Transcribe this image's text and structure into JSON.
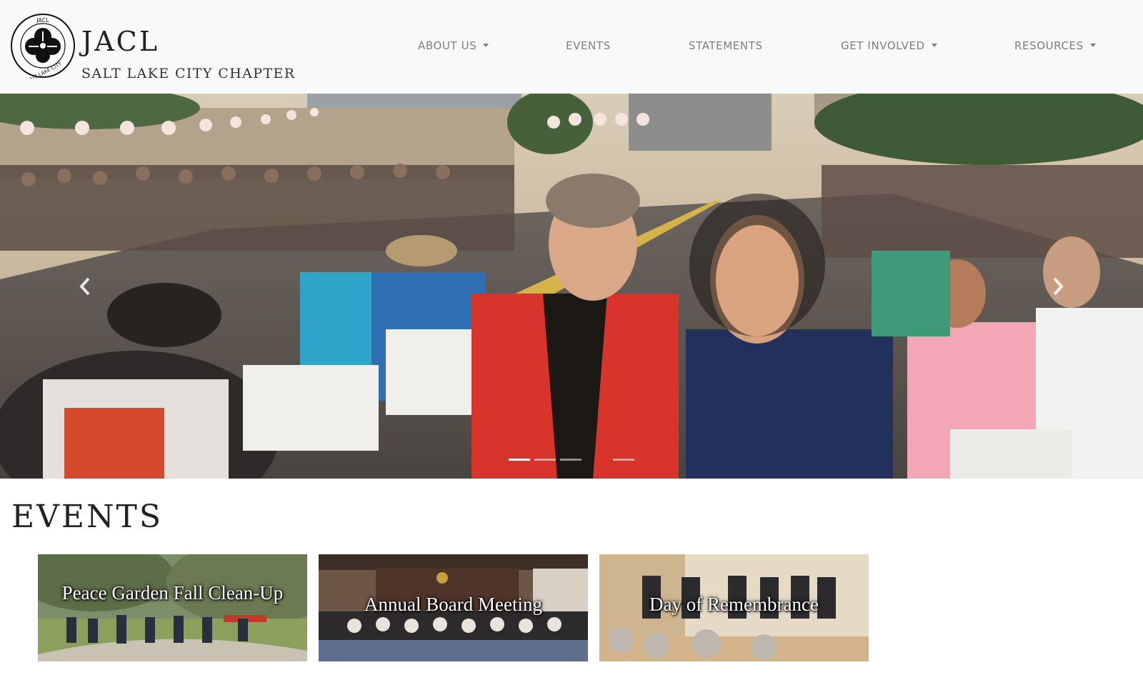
{
  "header": {
    "logo_text": "JACL SALT LAKE CITY",
    "brand_name": "JACL",
    "brand_subtitle": "SALT LAKE CITY CHAPTER",
    "nav": [
      {
        "label": "ABOUT US",
        "dropdown": true
      },
      {
        "label": "EVENTS",
        "dropdown": false
      },
      {
        "label": "STATEMENTS",
        "dropdown": false
      },
      {
        "label": "GET INVOLVED",
        "dropdown": true
      },
      {
        "label": "RESOURCES",
        "dropdown": true
      }
    ]
  },
  "carousel": {
    "slide_count": 4,
    "active_index": 0,
    "prev_icon": "chevron-left-icon",
    "next_icon": "chevron-right-icon"
  },
  "events": {
    "heading": "EVENTS",
    "cards": [
      {
        "title": "Peace Garden Fall Clean-Up"
      },
      {
        "title": "Annual Board Meeting"
      },
      {
        "title": "Day of Remembrance"
      }
    ]
  },
  "colors": {
    "navbar_bg": "#f8f9fa",
    "nav_text": "#7b7f84",
    "heading_text": "#222222"
  }
}
